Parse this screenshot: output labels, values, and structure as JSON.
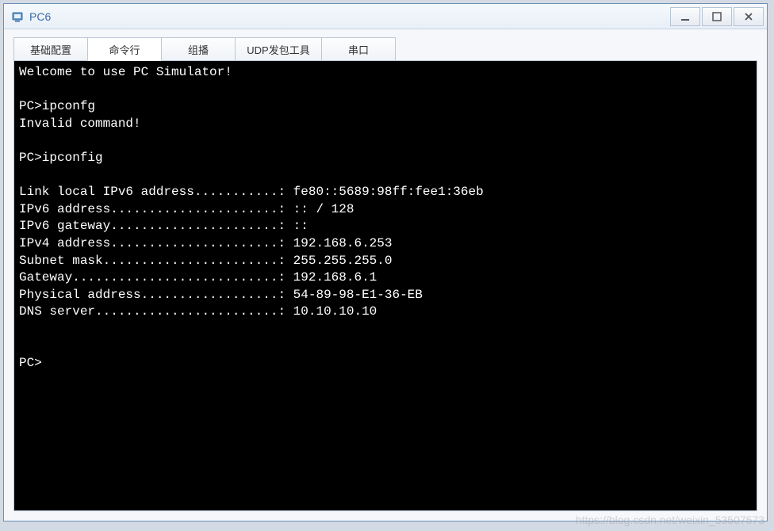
{
  "window": {
    "title": "PC6"
  },
  "tabs": [
    {
      "label": "基础配置"
    },
    {
      "label": "命令行"
    },
    {
      "label": "组播"
    },
    {
      "label": "UDP发包工具"
    },
    {
      "label": "串口"
    }
  ],
  "terminal": {
    "lines": [
      "Welcome to use PC Simulator!",
      "",
      "PC>ipconfg",
      "Invalid command!",
      "",
      "PC>ipconfig",
      "",
      "Link local IPv6 address...........: fe80::5689:98ff:fee1:36eb",
      "IPv6 address......................: :: / 128",
      "IPv6 gateway......................: ::",
      "IPv4 address......................: 192.168.6.253",
      "Subnet mask.......................: 255.255.255.0",
      "Gateway...........................: 192.168.6.1",
      "Physical address..................: 54-89-98-E1-36-EB",
      "DNS server........................: 10.10.10.10",
      "",
      "",
      "PC>"
    ]
  },
  "watermark": "https://blog.csdn.net/weixin_53507573"
}
